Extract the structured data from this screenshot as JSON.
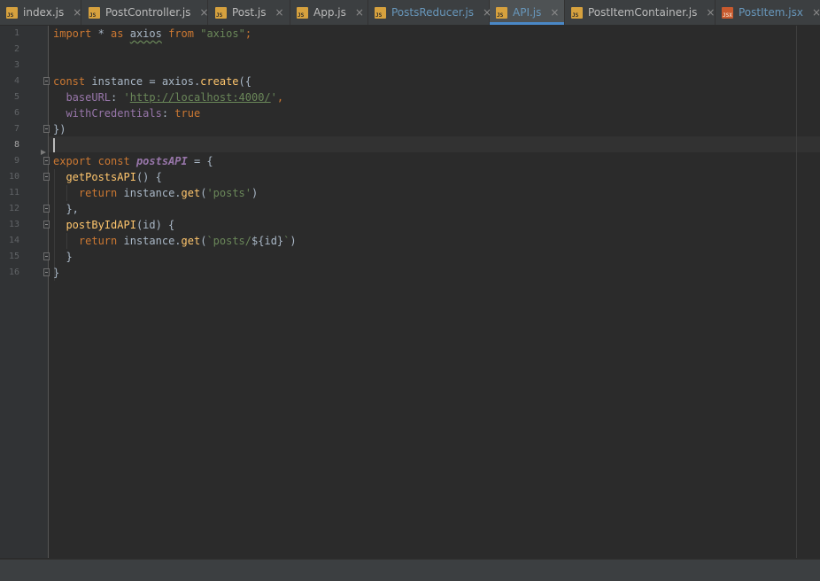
{
  "tabs": [
    {
      "label": "index.js",
      "icon": "js-file-icon",
      "modified": false,
      "active": false
    },
    {
      "label": "PostController.js",
      "icon": "js-file-icon",
      "modified": false,
      "active": false
    },
    {
      "label": "Post.js",
      "icon": "js-file-icon",
      "modified": false,
      "active": false
    },
    {
      "label": "App.js",
      "icon": "js-file-icon",
      "modified": false,
      "active": false
    },
    {
      "label": "PostsReducer.js",
      "icon": "js-file-icon",
      "modified": true,
      "active": false
    },
    {
      "label": "API.js",
      "icon": "js-file-icon",
      "modified": true,
      "active": true
    },
    {
      "label": "PostItemContainer.js",
      "icon": "js-file-icon",
      "modified": false,
      "active": false
    },
    {
      "label": "PostItem.jsx",
      "icon": "jsx-file-icon",
      "modified": true,
      "active": false
    }
  ],
  "icon_text": {
    "js": "JS",
    "jsx": "JSX"
  },
  "close_glyph": "×",
  "editor": {
    "current_line": 8,
    "line_numbers": [
      "1",
      "2",
      "3",
      "4",
      "5",
      "6",
      "7",
      "8",
      "9",
      "10",
      "11",
      "12",
      "13",
      "14",
      "15",
      "16"
    ],
    "code": {
      "l1": {
        "t1": "import",
        "t2": " * ",
        "t3": "as",
        "t4": " ",
        "t5": "axios",
        "t6": " ",
        "t7": "from",
        "t8": " ",
        "t9": "\"axios\"",
        "t10": ";"
      },
      "l4": {
        "t1": "const",
        "t2": " instance = axios.",
        "t3": "create",
        "t4": "({"
      },
      "l5": {
        "t1": "  ",
        "t2": "baseURL",
        "t3": ": ",
        "t4": "'",
        "t5": "http://localhost:4000/",
        "t6": "'",
        "t7": ","
      },
      "l6": {
        "t1": "  ",
        "t2": "withCredentials",
        "t3": ": ",
        "t4": "true"
      },
      "l7": {
        "t1": "})"
      },
      "l9": {
        "t1": "export",
        "t2": " ",
        "t3": "const",
        "t4": " ",
        "t5": "postsAPI",
        "t6": " = {"
      },
      "l10": {
        "t1": "  ",
        "t2": "getPostsAPI",
        "t3": "() {"
      },
      "l11": {
        "t1": "    ",
        "t2": "return",
        "t3": " instance.",
        "t4": "get",
        "t5": "(",
        "t6": "'posts'",
        "t7": ")"
      },
      "l12": {
        "t1": "  },"
      },
      "l13": {
        "t1": "  ",
        "t2": "postByIdAPI",
        "t3": "(id) {"
      },
      "l14": {
        "t1": "    ",
        "t2": "return",
        "t3": " instance.",
        "t4": "get",
        "t5": "(",
        "t6": "`posts/",
        "t7": "${id}",
        "t8": "`",
        "t9": ")"
      },
      "l15": {
        "t1": "  }"
      },
      "l16": {
        "t1": "}"
      }
    }
  },
  "colors": {
    "background": "#2b2b2b",
    "keyword": "#cc7832",
    "string": "#6a8759",
    "property": "#9876aa",
    "function": "#ffc66d",
    "text": "#a9b7c6",
    "active_tab_underline": "#4a88c7",
    "modified_tab_text": "#6897bb"
  }
}
